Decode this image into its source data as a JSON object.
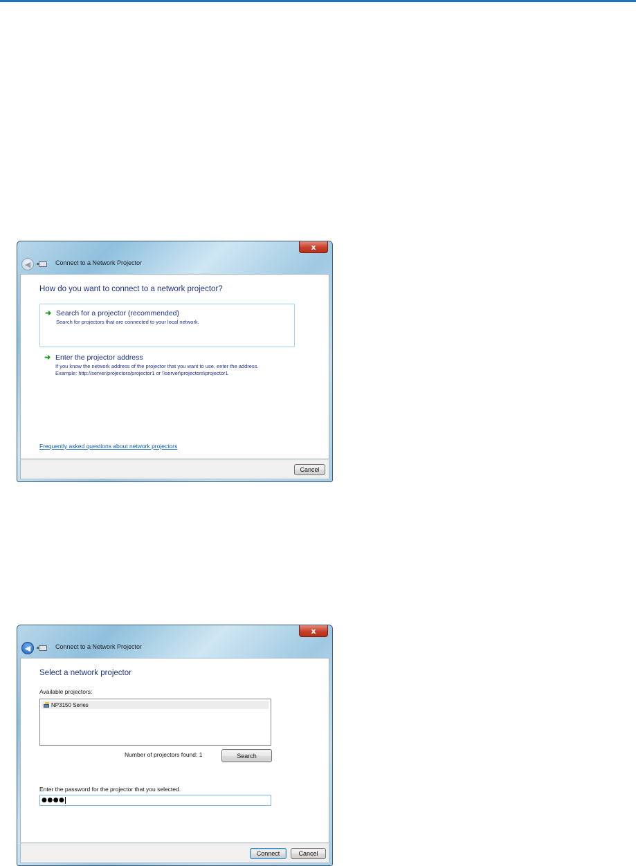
{
  "window1": {
    "title": "Connect to a Network Projector",
    "close_glyph": "x",
    "question": "How do you want to connect to a network projector?",
    "option_search": {
      "title": "Search for a projector (recommended)",
      "description": "Search for projectors that are connected to your local network."
    },
    "option_address": {
      "title": "Enter the projector address",
      "description_line1": "If you know the network address of the projector that you want to use, enter the address.",
      "description_line2": "Example: http://server/projectors/projector1 or \\\\server\\projectors\\projector1"
    },
    "faq_link": "Frequently asked questions about network projectors",
    "cancel_label": "Cancel"
  },
  "window2": {
    "title": "Connect to a Network Projector",
    "close_glyph": "x",
    "heading": "Select a network projector",
    "available_label": "Available projectors:",
    "projectors": [
      "NP3150 Series"
    ],
    "found_text": "Number of projectors found: 1",
    "search_label": "Search",
    "password_label": "Enter the password for the projector that you selected.",
    "password_value": "●●●●",
    "connect_label": "Connect",
    "cancel_label": "Cancel"
  },
  "colors": {
    "accent_rule": "#1f72b8",
    "heading_text": "#1e3287",
    "link": "#0b5aa8",
    "option_arrow": "#1d9b1d",
    "close_button": "#c9402a"
  },
  "icons": [
    "back-arrow-icon",
    "network-projector-icon",
    "green-arrow-icon",
    "network-device-icon",
    "close-icon"
  ]
}
